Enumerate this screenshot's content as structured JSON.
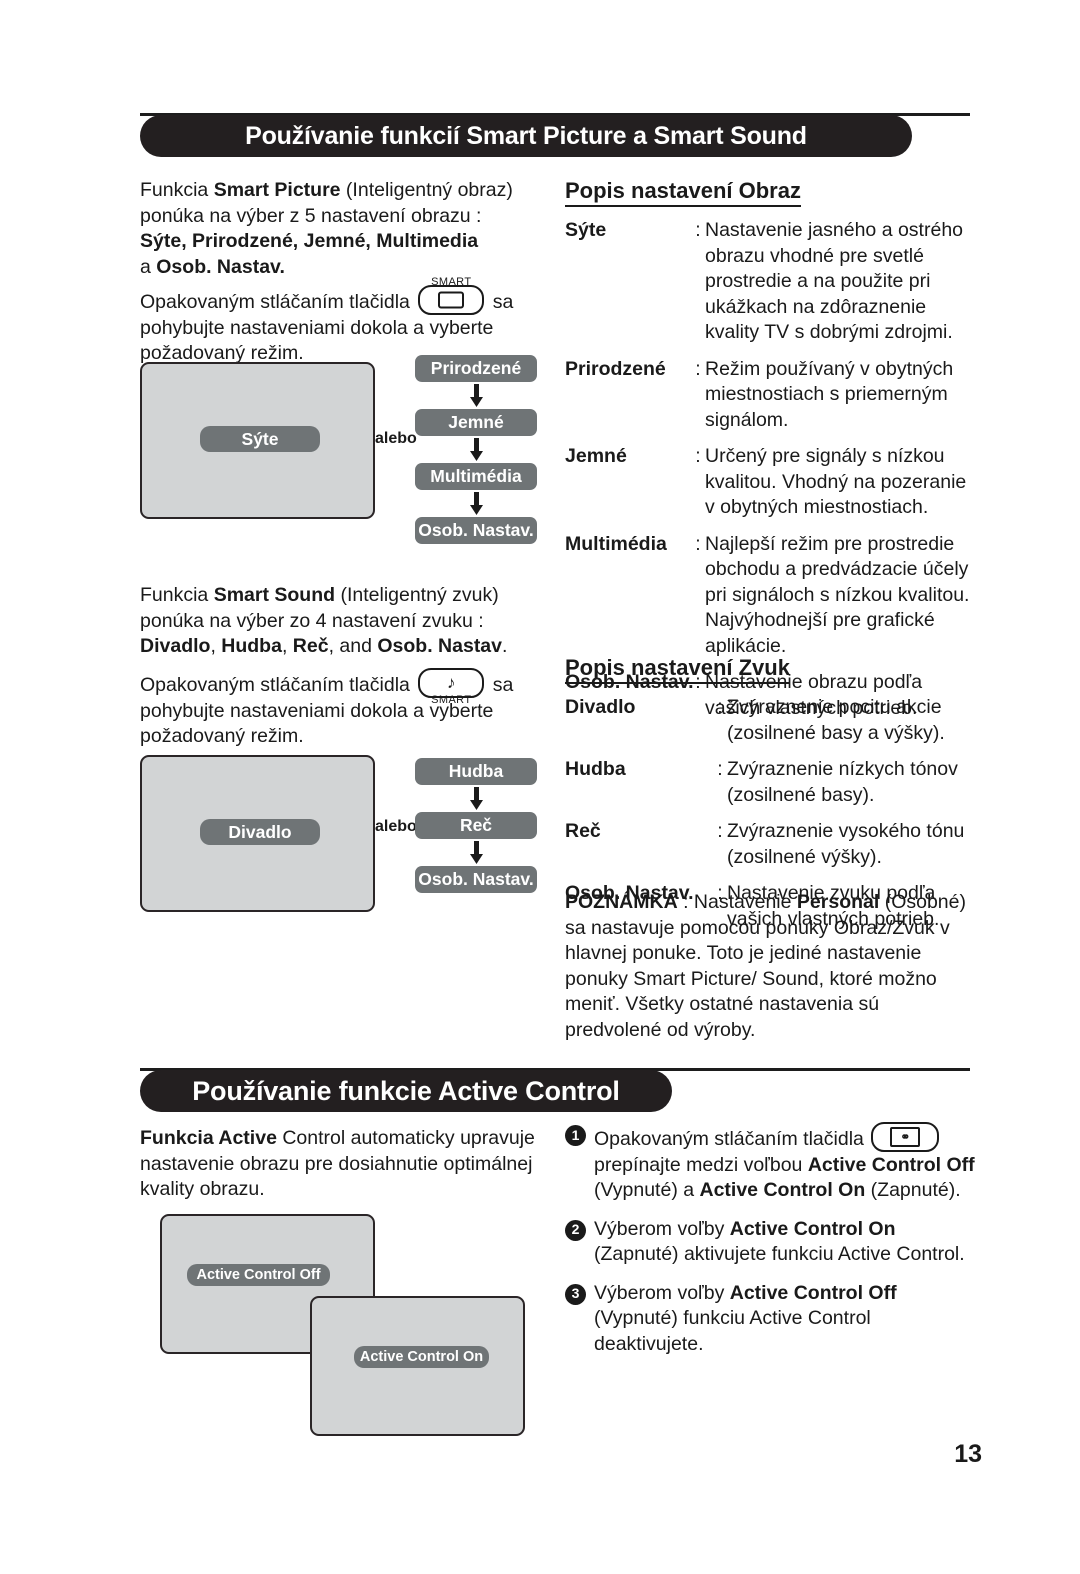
{
  "page": {
    "number": "13"
  },
  "sections": {
    "smart": {
      "title": "Používanie funkcií Smart Picture a Smart Sound",
      "picture_intro": {
        "line1_pre": "Funkcia ",
        "line1_bold": "Smart Picture",
        "line1_post": " (Inteligentný obraz)",
        "line2": "ponúka na výber z 5 nastavení obrazu :",
        "line3_bold": "Sýte, Prirodzené, Jemné, Multimedia",
        "line4_pre": "a ",
        "line4_bold": "Osob. Nastav."
      },
      "picture_press": {
        "pre": "Opakovaným stláčaním tlačidla",
        "post": "sa",
        "line2": "pohybujte nastaveniami dokola a vyberte",
        "line3": "požadovaný režim.",
        "button_caption": "SMART",
        "button_icon": "picture-icon"
      },
      "picture_flow": {
        "screen_label": "Sýte",
        "alebo": "alebo",
        "nodes": [
          "Prirodzené",
          "Jemné",
          "Multimédia",
          "Osob. Nastav."
        ]
      },
      "sound_intro": {
        "line1_pre": "Funkcia ",
        "line1_bold": "Smart Sound",
        "line1_post": " (Inteligentný zvuk)",
        "line2": "ponúka na výber zo 4 nastavení zvuku :",
        "line3_b1": "Divadlo",
        "line3_s1": ", ",
        "line3_b2": "Hudba",
        "line3_s2": ", ",
        "line3_b3": "Reč",
        "line3_s3": ", and ",
        "line3_b4": "Osob. Nastav",
        "line3_s4": "."
      },
      "sound_press": {
        "pre": "Opakovaným stláčaním tlačidla",
        "post": "sa",
        "line2": "pohybujte nastaveniami dokola a vyberte",
        "line3": "požadovaný režim.",
        "button_caption": "SMART",
        "button_icon": "music-note-icon"
      },
      "sound_flow": {
        "screen_label": "Divadlo",
        "alebo": "alebo",
        "nodes": [
          "Hudba",
          "Reč",
          "Osob. Nastav."
        ]
      },
      "picture_desc": {
        "heading": "Popis nastavení Obraz",
        "items": [
          {
            "term": "Sýte",
            "colon": ":",
            "desc": "Nastavenie jasného a ostrého obrazu vhodné pre svetlé prostredie a na použite pri ukážkach na zdôraznenie kvality TV s dobrými zdrojmi."
          },
          {
            "term": "Prirodzené",
            "colon": ":",
            "desc": "Režim používaný v obytných miestnostiach s priemerným signálom."
          },
          {
            "term": "Jemné",
            "colon": ":",
            "desc": "Určený pre signály s nízkou kvalitou. Vhodný na pozeranie v obytných miestnostiach."
          },
          {
            "term": "Multimédia",
            "colon": ":",
            "desc": "Najlepší režim pre prostredie obchodu a predvádzacie účely pri signáloch s nízkou kvalitou. Najvýhodnejší pre grafické aplikácie."
          },
          {
            "term": "Osob. Nastav.",
            "colon": ":",
            "desc": "Nastavenie obrazu podľa vašich vlastných potrieb."
          }
        ]
      },
      "sound_desc": {
        "heading": "Popis nastavení Zvuk",
        "items": [
          {
            "term": "Divadlo",
            "colon": ":",
            "desc": "Zvýraznenie pocitu akcie (zosilnené basy a výšky)."
          },
          {
            "term": "Hudba",
            "colon": ":",
            "desc": "Zvýraznenie nízkych tónov (zosilnené basy)."
          },
          {
            "term": "Reč",
            "colon": ":",
            "desc": "Zvýraznenie vysokého tónu (zosilnené výšky)."
          },
          {
            "term": "Osob. Nastav.",
            "colon": ":",
            "desc": "Nastavenie zvuku podľa vašich vlastných potrieb."
          }
        ]
      },
      "note": {
        "label": "POZNÁMKA",
        "sep": " : Nastavenie ",
        "bold_term": "Personal",
        "rest": "(Osobné) sa nastavuje pomocou ponuky Obraz/Zvuk v hlavnej ponuke. Toto je jediné nastavenie ponuky Smart Picture/ Sound, ktoré možno meniť. Všetky ostatné nastavenia sú predvolené od výroby."
      }
    },
    "active": {
      "title": "Používanie funkcie Active Control",
      "intro": {
        "bold": "Funkcia Active",
        "rest": " Control automaticky upravuje nastavenie obrazu pre dosiahnutie optimálnej kvality obrazu."
      },
      "screens": {
        "off_label": "Active Control Off",
        "on_label": "Active Control On"
      },
      "steps": [
        {
          "num": "1",
          "pre": "Opakovaným stláčaním tlačidla",
          "button_icon": "active-control-icon",
          "mid1": "prepínajte medzi voľbou ",
          "bold1": "Active Control Off",
          "mid2": " (Vypnuté) a ",
          "bold2": "Active Control On",
          "mid3": " (Zapnuté)."
        },
        {
          "num": "2",
          "pre": "Výberom voľby ",
          "bold1": "Active Control On",
          "mid1": " (Zapnuté) aktivujete funkciu Active Control."
        },
        {
          "num": "3",
          "pre": "Výberom voľby ",
          "bold1": "Active Control Off",
          "mid1": " (Vypnuté) funkciu Active Control deaktivujete."
        }
      ]
    }
  },
  "colors": {
    "header_bar": "#231f20",
    "osd_pill": "#6f7476",
    "tv_screen": "#d2d4d5",
    "text": "#1a1a1a"
  }
}
